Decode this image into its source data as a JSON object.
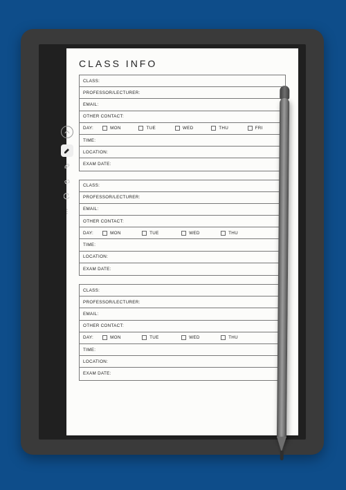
{
  "title": "CLASS INFO",
  "labels": {
    "class": "CLASS:",
    "professor": "PROFESSOR/LECTURER:",
    "email": "EMAIL:",
    "other_contact": "OTHER CONTACT:",
    "day": "DAY:",
    "time": "TIME:",
    "location": "LOCATION:",
    "exam_date": "EXAM DATE:"
  },
  "blocks": [
    {
      "days": [
        "MON",
        "TUE",
        "WED",
        "THU",
        "FRI"
      ]
    },
    {
      "days": [
        "MON",
        "TUE",
        "WED",
        "THU"
      ]
    },
    {
      "days": [
        "MON",
        "TUE",
        "WED",
        "THU"
      ]
    }
  ],
  "toolbar": {
    "collapse": "chevron-up",
    "items": [
      "pen",
      "highlighter",
      "eraser",
      "undo",
      "more"
    ]
  }
}
